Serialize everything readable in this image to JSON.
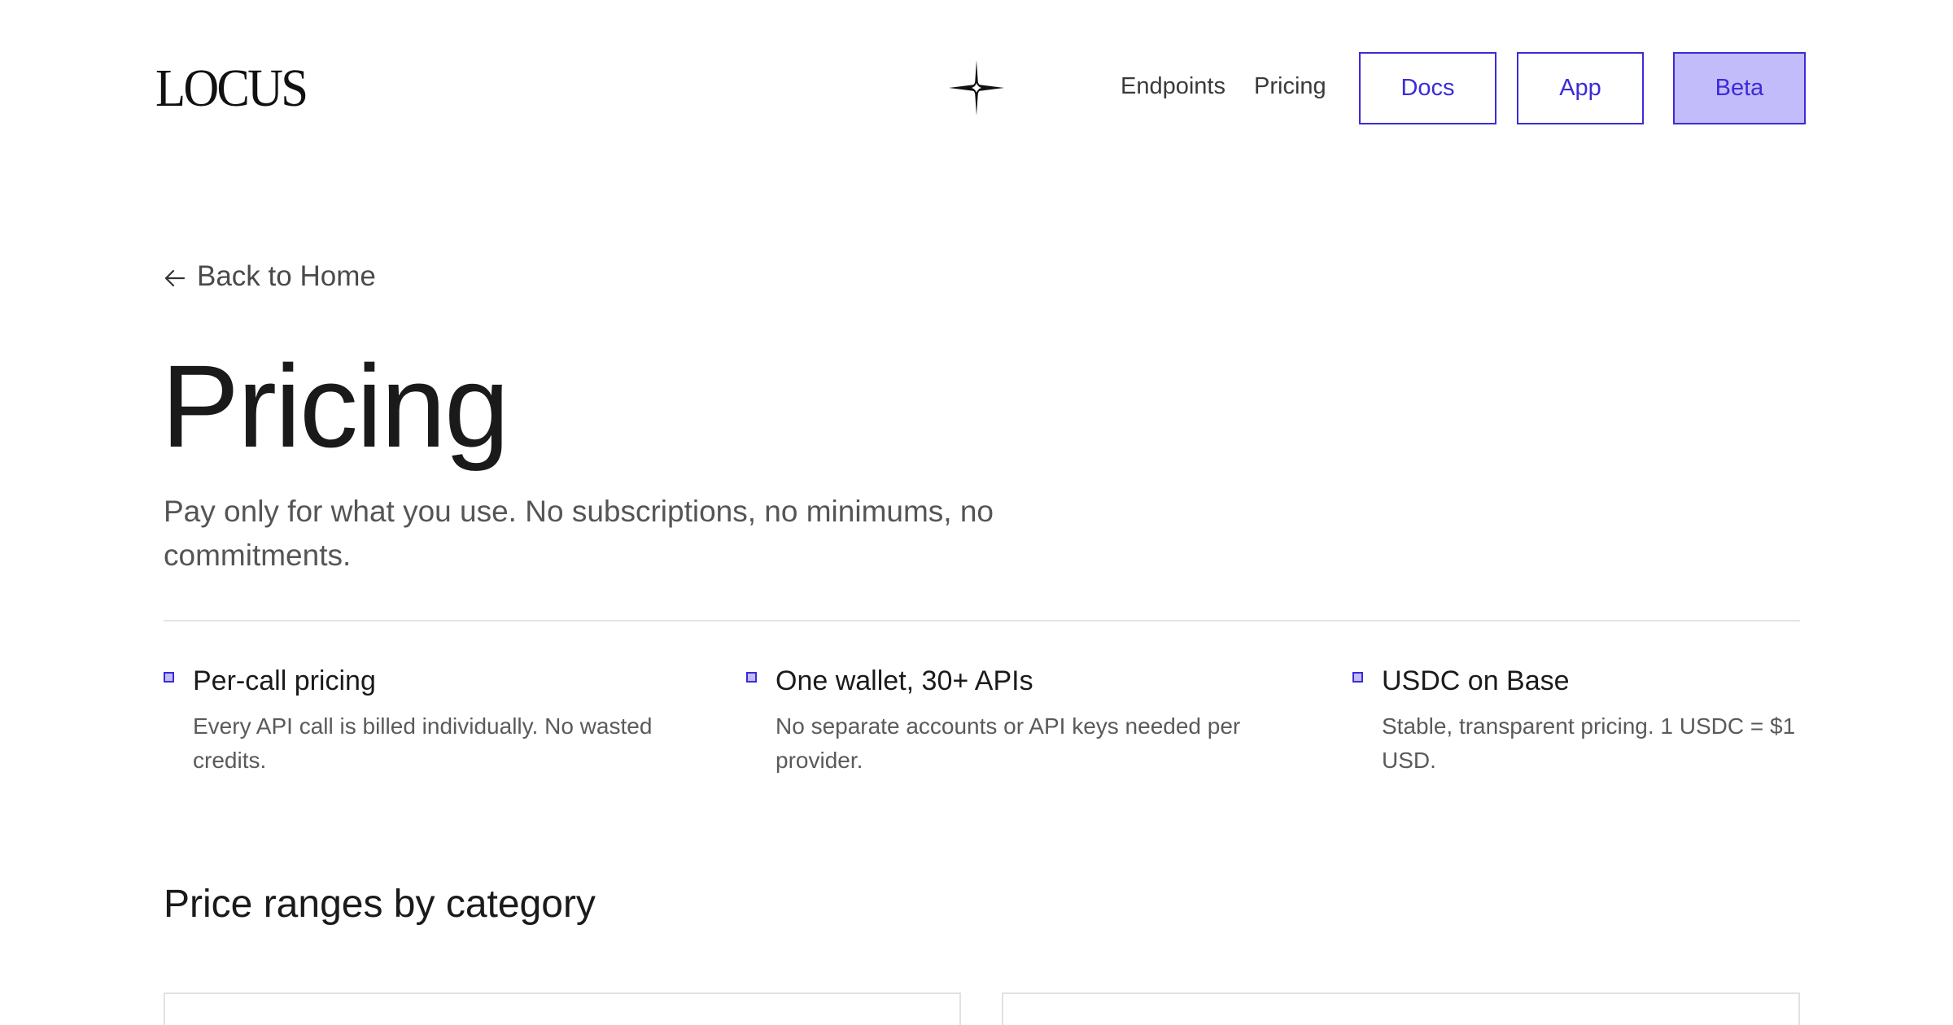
{
  "header": {
    "logo": "LOCUS",
    "nav": {
      "endpoints": "Endpoints",
      "pricing": "Pricing"
    },
    "buttons": {
      "docs": "Docs",
      "app": "App",
      "beta": "Beta"
    },
    "accent_color": "#3b2bd8",
    "highlight_color": "#c3bcfb"
  },
  "main": {
    "back_link": "Back to Home",
    "title": "Pricing",
    "subtitle": "Pay only for what you use. No subscriptions, no minimums, no commitments.",
    "features": [
      {
        "title": "Per-call pricing",
        "description": "Every API call is billed individually. No wasted credits."
      },
      {
        "title": "One wallet, 30+ APIs",
        "description": "No separate accounts or API keys needed per provider."
      },
      {
        "title": "USDC on Base",
        "description": "Stable, transparent pricing. 1 USDC = $1 USD."
      }
    ],
    "section_title": "Price ranges by category"
  },
  "icons": {
    "sparkle": "sparkle-icon",
    "back_arrow": "arrow-left-icon",
    "feature_marker": "square-bullet-icon"
  }
}
